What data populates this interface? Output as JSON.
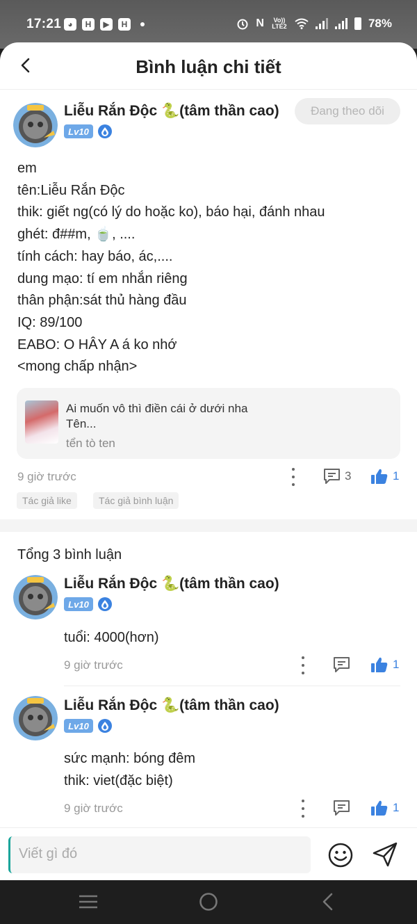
{
  "status_bar": {
    "time": "17:21",
    "network": "Vo)) LTE2",
    "battery": "78%",
    "colors": {
      "bg": "#5f5f5f"
    }
  },
  "header": {
    "title": "Bình luận chi tiết"
  },
  "post": {
    "author": "Liễu Rắn Độc 🐍(tâm thần cao)",
    "level": "Lv10",
    "follow_label": "Đang theo dõi",
    "lines": [
      "em",
      "tên:Liễu Rắn Độc",
      "thik: giết ng(có lý do hoặc ko), báo hại, đánh nhau",
      "ghét: đ##m, 🍵, ....",
      "tính cách: hay báo, ác,....",
      "dung mạo: tí em nhắn riêng",
      "thân phận:sát thủ hàng đầu",
      "IQ: 89/100",
      "EABO: O HÂY A á ko nhớ",
      "<mong chấp nhận>"
    ],
    "quote": {
      "title": "Ai muốn vô thì điền cái ở dưới nha",
      "subtitle": "Tên...",
      "author": "tển tò ten"
    },
    "time": "9 giờ trước",
    "comment_count": "3",
    "like_count": "1",
    "tags": [
      "Tác giả like",
      "Tác giả bình luận"
    ]
  },
  "comments_section": {
    "total_label": "Tổng 3 bình luận",
    "comments": [
      {
        "author": "Liễu Rắn Độc 🐍(tâm thần cao)",
        "level": "Lv10",
        "lines": [
          "tuổi: 4000(hơn)"
        ],
        "time": "9 giờ trước",
        "likes": "1"
      },
      {
        "author": "Liễu Rắn Độc 🐍(tâm thần cao)",
        "level": "Lv10",
        "lines": [
          "sức mạnh: bóng đêm",
          "thik: viet(đặc biệt)"
        ],
        "time": "9 giờ trước",
        "likes": "1"
      }
    ]
  },
  "input_bar": {
    "placeholder": "Viết gì đó"
  },
  "icons": [
    "back-icon",
    "emoji-icon",
    "send-icon",
    "more-icon",
    "comment-icon",
    "thumbs-up-icon",
    "home-icon",
    "recents-icon",
    "nav-back-icon"
  ],
  "colors": {
    "accent": "#3b82e0",
    "level_badge": "#6ea8e8",
    "cursor": "#1aa59b"
  }
}
